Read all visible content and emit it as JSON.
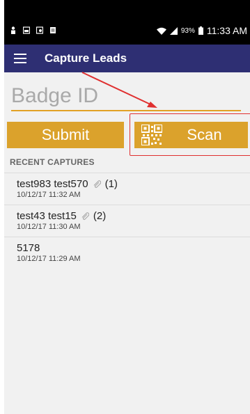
{
  "status_bar": {
    "battery_pct": "93%",
    "time": "11:33 AM"
  },
  "app_bar": {
    "title": "Capture Leads"
  },
  "badge_field": {
    "placeholder": "Badge ID"
  },
  "buttons": {
    "submit_label": "Submit",
    "scan_label": "Scan"
  },
  "recent": {
    "header": "RECENT CAPTURES",
    "items": [
      {
        "name": "test983 test570",
        "count": "(1)",
        "timestamp": "10/12/17 11:32 AM",
        "has_attachment": true
      },
      {
        "name": "test43 test15",
        "count": "(2)",
        "timestamp": "10/12/17 11:30 AM",
        "has_attachment": true
      },
      {
        "name": "5178",
        "count": "",
        "timestamp": "10/12/17 11:29 AM",
        "has_attachment": false
      }
    ]
  },
  "colors": {
    "app_bar": "#2e2f73",
    "accent": "#dba22c",
    "annotation": "#e03030"
  },
  "icons": [
    "menu-icon",
    "qr-code-icon",
    "paperclip-icon",
    "wifi-icon",
    "signal-icon",
    "battery-icon"
  ]
}
